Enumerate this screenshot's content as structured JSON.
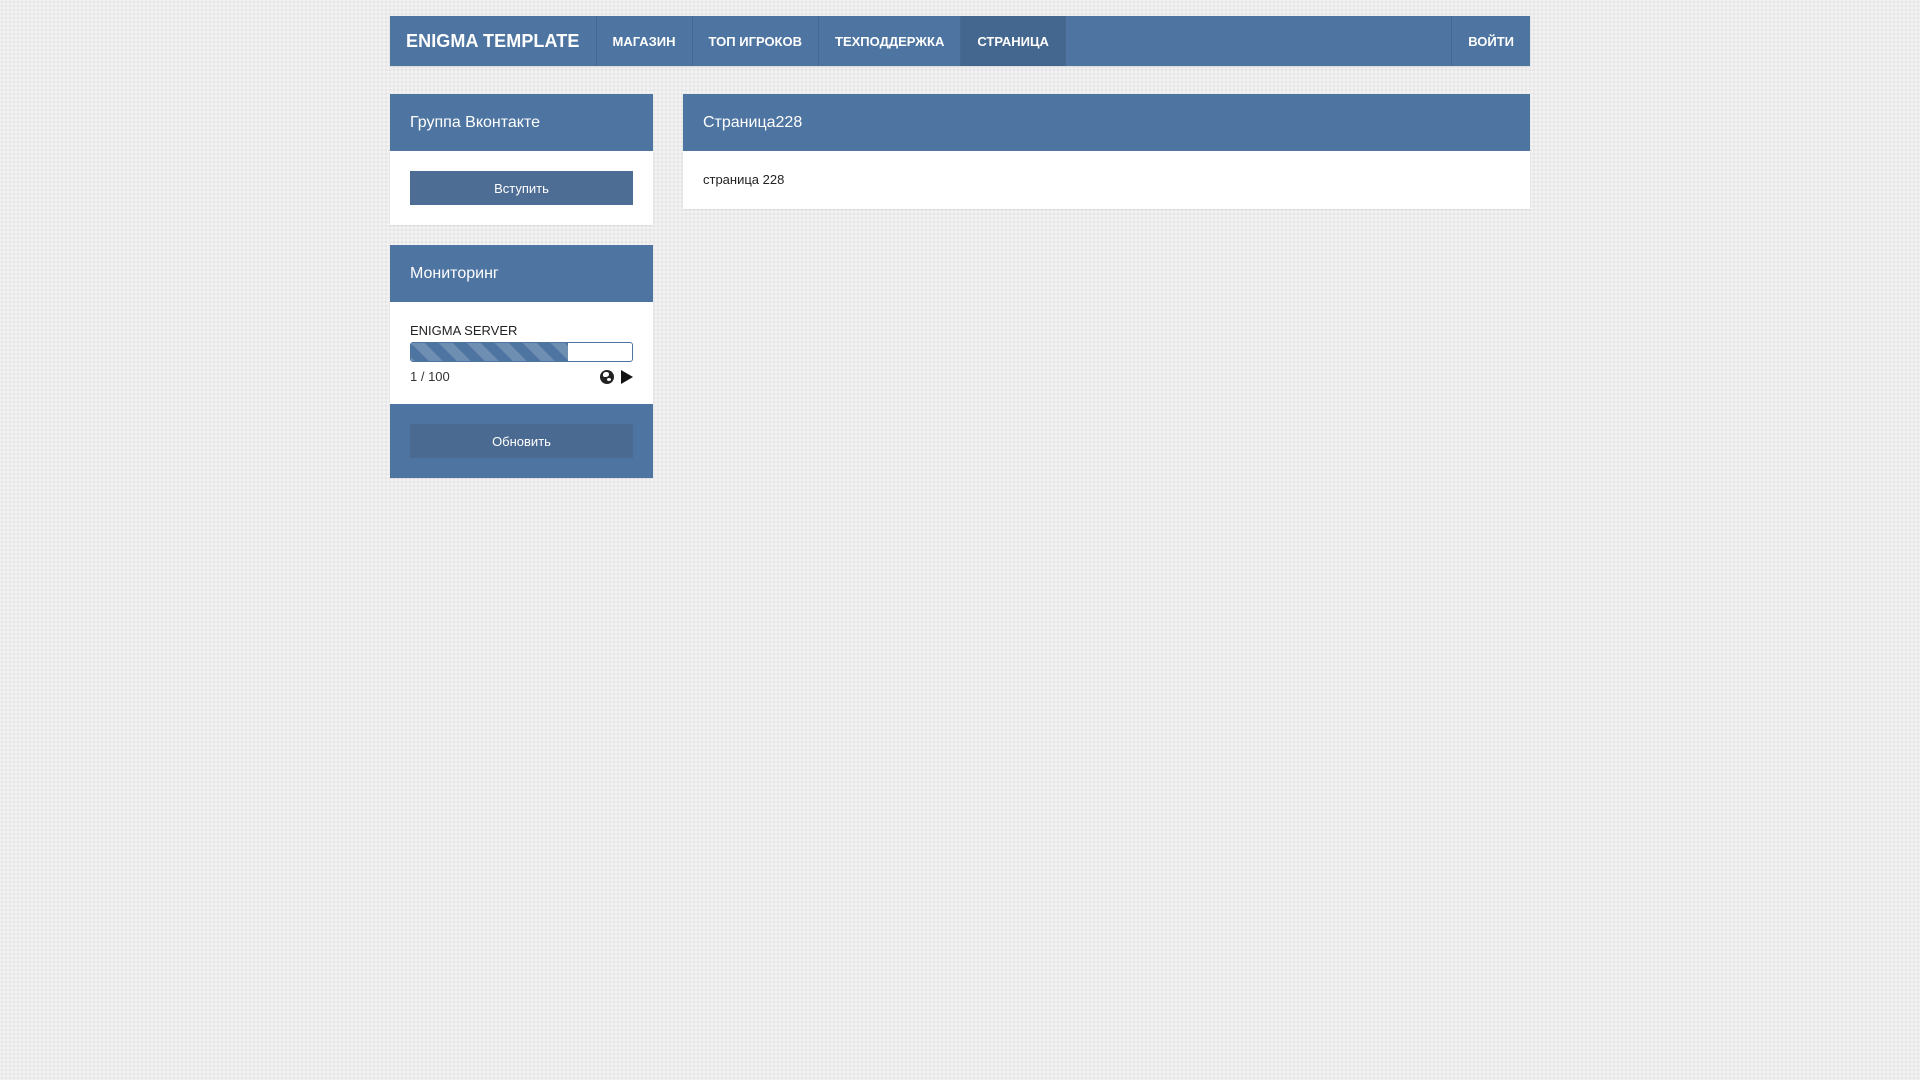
{
  "navbar": {
    "brand": "ENIGMA TEMPLATE",
    "items": [
      {
        "label": "МАГАЗИН"
      },
      {
        "label": "ТОП ИГРОКОВ"
      },
      {
        "label": "ТЕХПОДДЕРЖКА"
      },
      {
        "label": "СТРАНИЦА",
        "active": true
      }
    ],
    "login": "ВОЙТИ"
  },
  "sidebar": {
    "vk": {
      "title": "Группа Вконтакте",
      "button": "Вступить"
    },
    "monitoring": {
      "title": "Мониторинг",
      "server_name": "ENIGMA SERVER",
      "players": "1 / 100",
      "progress_fill_fraction": 0.71,
      "refresh_button": "Обновить",
      "icons": [
        "globe-icon",
        "play-icon"
      ]
    }
  },
  "main": {
    "title": "Страница228",
    "body": "страница 228"
  },
  "colors": {
    "accent": "#4e75a1",
    "accent_dark": "#43678f",
    "background": "#ececec"
  }
}
